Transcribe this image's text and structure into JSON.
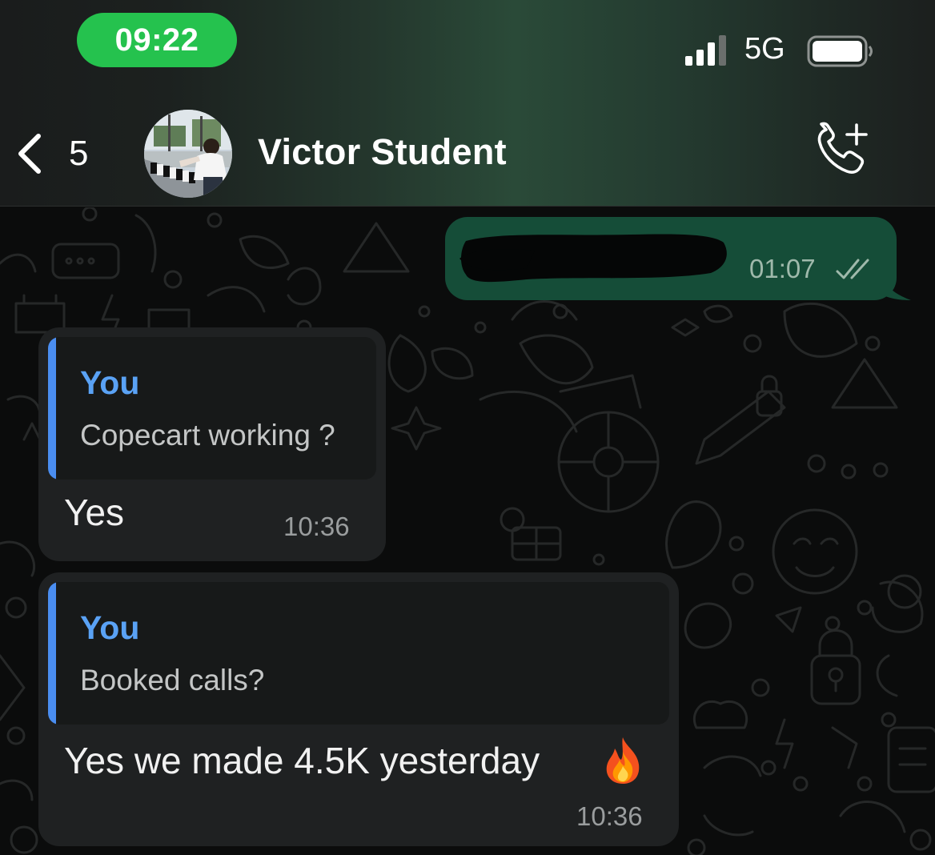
{
  "status_bar": {
    "time": "09:22",
    "network": "5G"
  },
  "header": {
    "back_count": "5",
    "contact_name": "Victor Student"
  },
  "messages": [
    {
      "direction": "outgoing",
      "text_redacted": true,
      "time": "01:07",
      "status": "read"
    },
    {
      "direction": "incoming",
      "quote_author": "You",
      "quote_text": "Copecart working ?",
      "text": "Yes",
      "time": "10:36"
    },
    {
      "direction": "incoming",
      "quote_author": "You",
      "quote_text": "Booked calls?",
      "text": "Yes we made 4.5K yesterday",
      "emoji": "fire",
      "time": "10:36"
    }
  ],
  "colors": {
    "time_pill": "#25c24e",
    "outgoing_bubble": "#154d38",
    "incoming_bubble": "#1f2122",
    "quote_accent": "#4a8df0",
    "quote_author": "#5aa2f5"
  },
  "icons": {
    "back": "chevron-left-icon",
    "call": "phone-add-icon",
    "signal": "signal-bars-icon",
    "battery": "battery-icon",
    "read": "double-check-icon",
    "emoji": "fire-emoji"
  }
}
